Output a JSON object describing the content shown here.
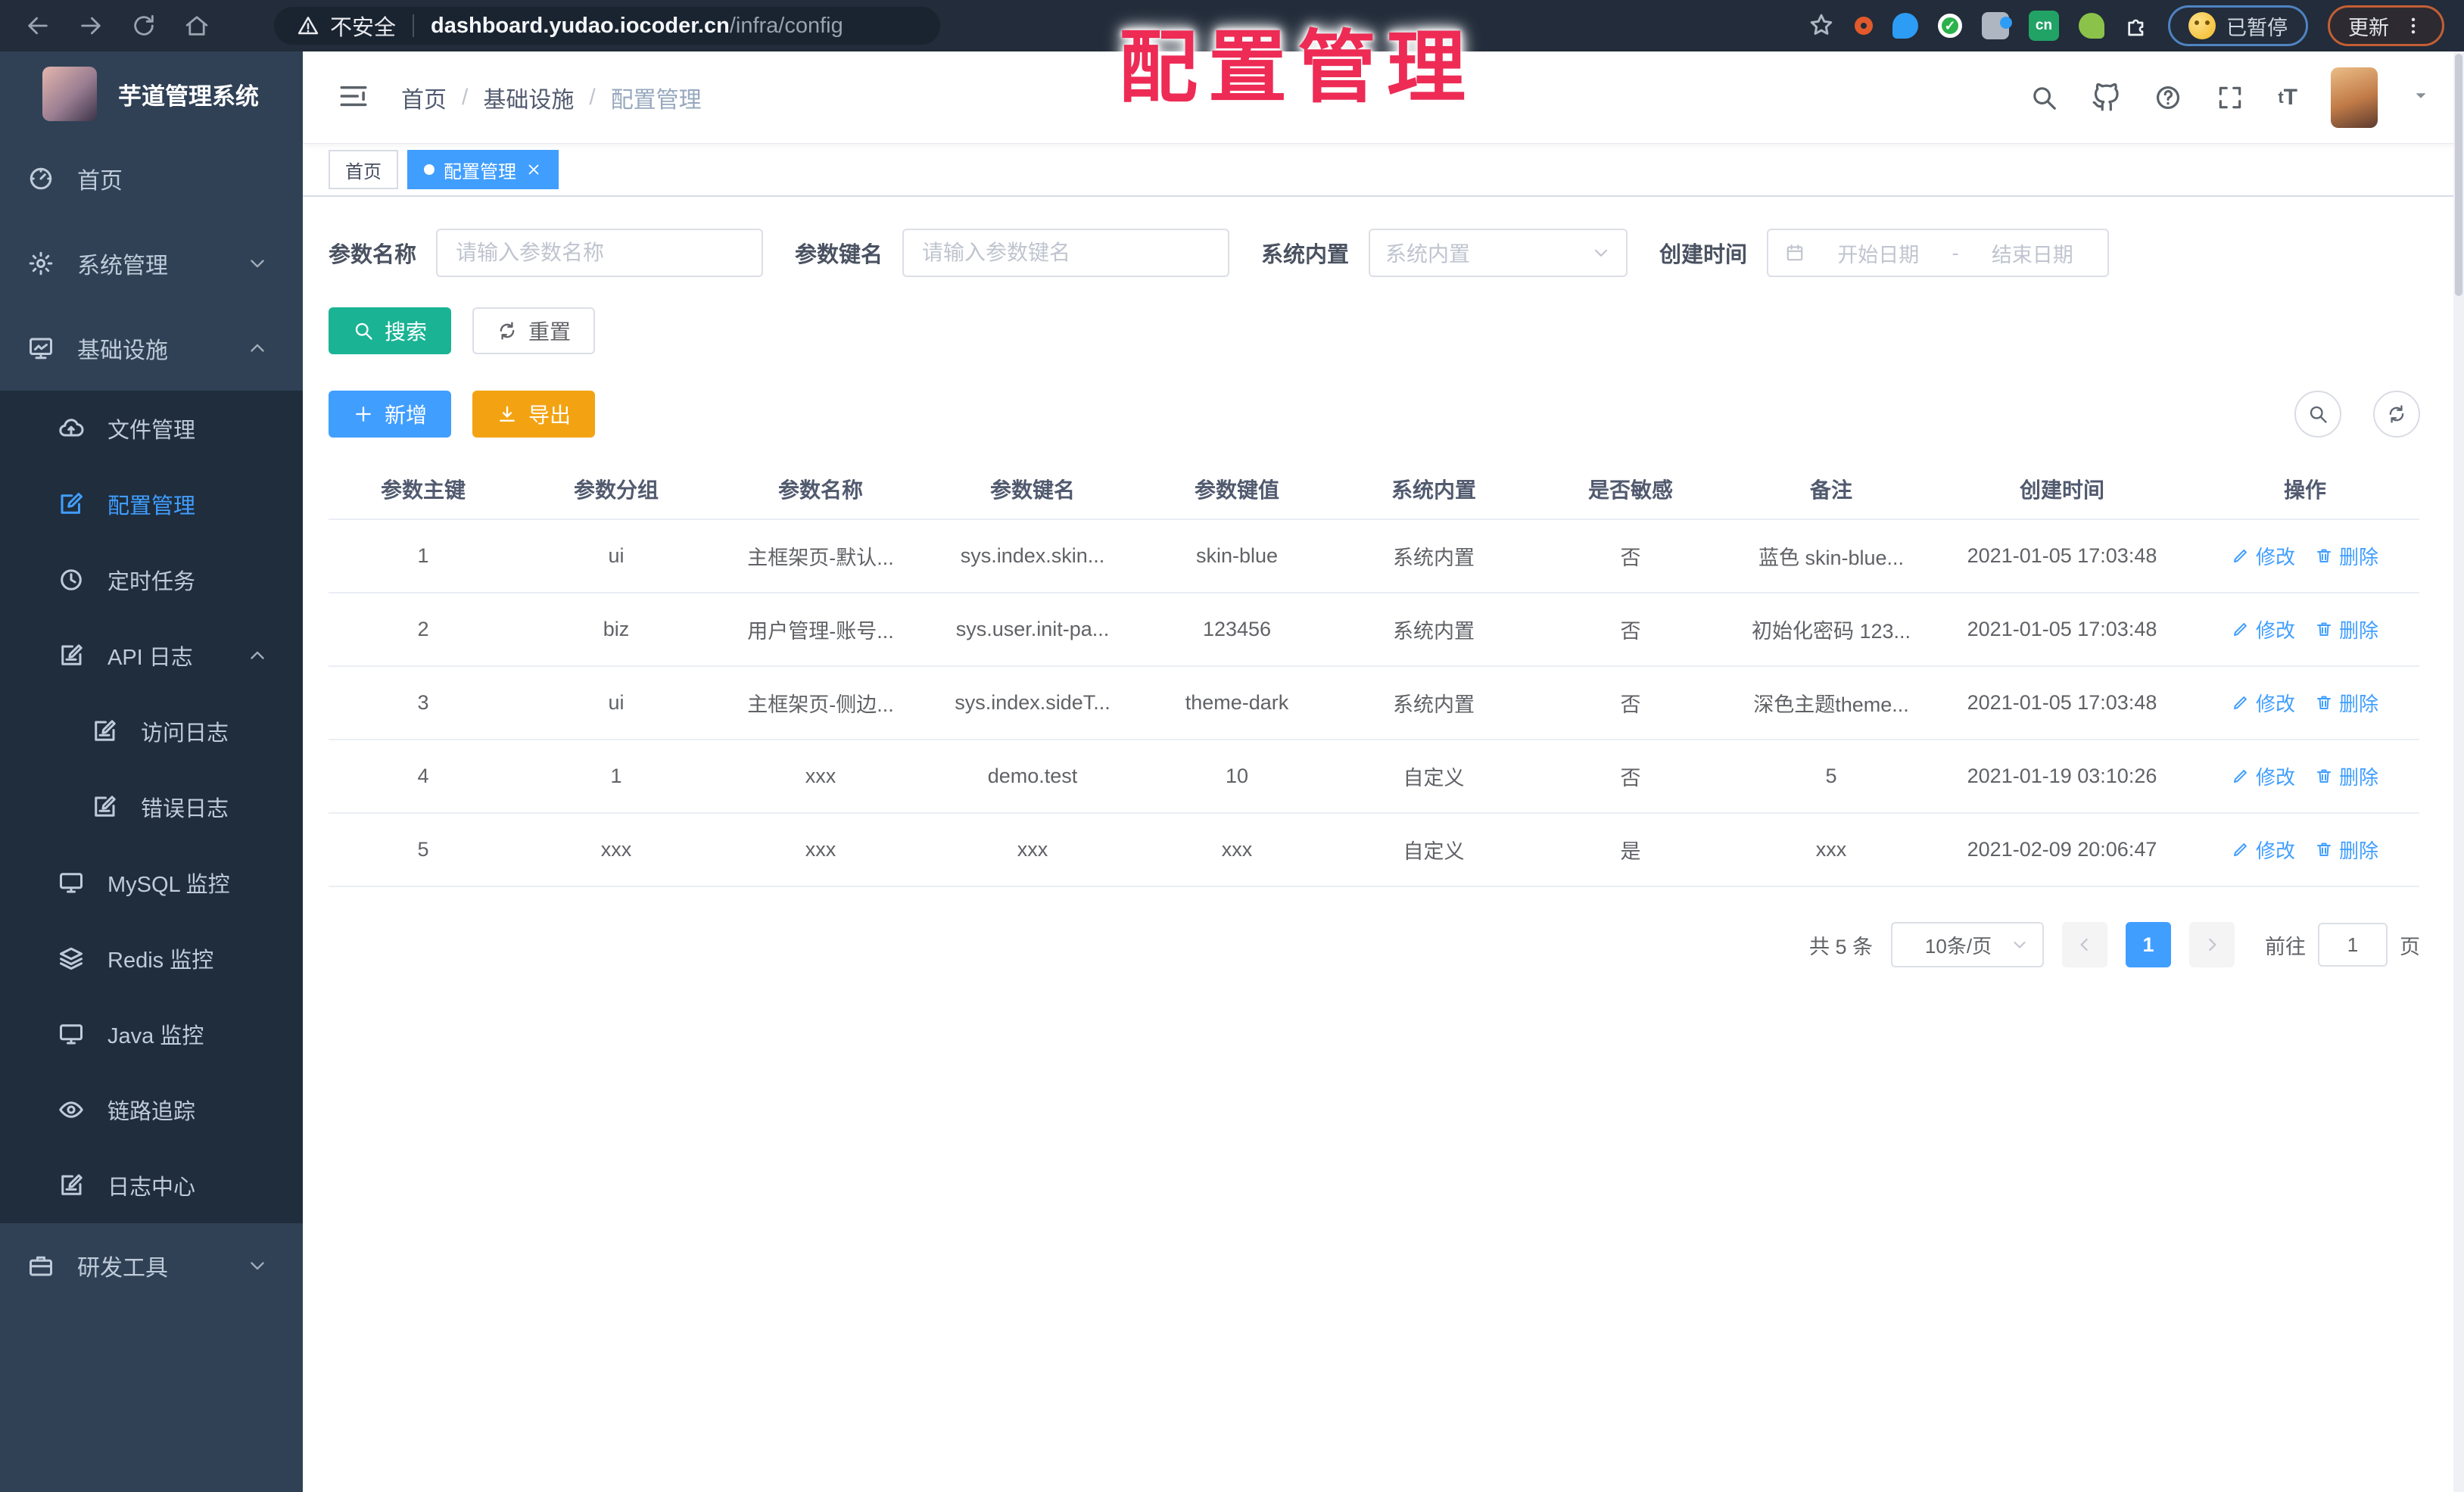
{
  "overlay": {
    "title": "配置管理"
  },
  "browser": {
    "security_text": "不安全",
    "url_domain": "dashboard.yudao.iocoder.cn",
    "url_path": "/infra/config",
    "paused_label": "已暂停",
    "update_label": "更新"
  },
  "sidebar": {
    "app_title": "芋道管理系统",
    "menu": [
      {
        "label": "首页",
        "icon": "dashboard-icon",
        "level": 1
      },
      {
        "label": "系统管理",
        "icon": "gear-icon",
        "level": 1,
        "chevron": "down"
      },
      {
        "label": "基础设施",
        "icon": "infrastructure-icon",
        "level": 1,
        "chevron": "up"
      },
      {
        "label": "文件管理",
        "icon": "cloud-upload-icon",
        "level": 2
      },
      {
        "label": "配置管理",
        "icon": "edit-square-icon",
        "level": 2,
        "active": true
      },
      {
        "label": "定时任务",
        "icon": "clock-icon",
        "level": 2
      },
      {
        "label": "API 日志",
        "icon": "log-icon",
        "level": 2,
        "chevron": "up"
      },
      {
        "label": "访问日志",
        "icon": "log-icon",
        "level": 3
      },
      {
        "label": "错误日志",
        "icon": "log-icon",
        "level": 3
      },
      {
        "label": "MySQL 监控",
        "icon": "monitor-icon",
        "level": 2
      },
      {
        "label": "Redis 监控",
        "icon": "layers-icon",
        "level": 2
      },
      {
        "label": "Java 监控",
        "icon": "monitor-icon",
        "level": 2
      },
      {
        "label": "链路追踪",
        "icon": "eye-icon",
        "level": 2
      },
      {
        "label": "日志中心",
        "icon": "log-icon",
        "level": 2
      },
      {
        "label": "研发工具",
        "icon": "briefcase-icon",
        "level": 1,
        "chevron": "down"
      }
    ]
  },
  "header": {
    "breadcrumb": [
      "首页",
      "基础设施",
      "配置管理"
    ],
    "breadcrumb_separator": "/"
  },
  "tags": [
    {
      "label": "首页"
    },
    {
      "label": "配置管理"
    }
  ],
  "filter": {
    "name_label": "参数名称",
    "name_placeholder": "请输入参数名称",
    "key_label": "参数键名",
    "key_placeholder": "请输入参数键名",
    "type_label": "系统内置",
    "type_placeholder": "系统内置",
    "date_label": "创建时间",
    "date_start": "开始日期",
    "date_separator": "-",
    "date_end": "结束日期",
    "search_label": "搜索",
    "reset_label": "重置"
  },
  "toolbar": {
    "add_label": "新增",
    "export_label": "导出"
  },
  "table": {
    "columns": [
      "参数主键",
      "参数分组",
      "参数名称",
      "参数键名",
      "参数键值",
      "系统内置",
      "是否敏感",
      "备注",
      "创建时间",
      "操作"
    ],
    "rows": [
      [
        "1",
        "ui",
        "主框架页-默认...",
        "sys.index.skin...",
        "skin-blue",
        "系统内置",
        "否",
        "蓝色 skin-blue...",
        "2021-01-05 17:03:48"
      ],
      [
        "2",
        "biz",
        "用户管理-账号...",
        "sys.user.init-pa...",
        "123456",
        "系统内置",
        "否",
        "初始化密码 123...",
        "2021-01-05 17:03:48"
      ],
      [
        "3",
        "ui",
        "主框架页-侧边...",
        "sys.index.sideT...",
        "theme-dark",
        "系统内置",
        "否",
        "深色主题theme...",
        "2021-01-05 17:03:48"
      ],
      [
        "4",
        "1",
        "xxx",
        "demo.test",
        "10",
        "自定义",
        "否",
        "5",
        "2021-01-19 03:10:26"
      ],
      [
        "5",
        "xxx",
        "xxx",
        "xxx",
        "xxx",
        "自定义",
        "是",
        "xxx",
        "2021-02-09 20:06:47"
      ]
    ],
    "edit_label": "修改",
    "delete_label": "删除"
  },
  "pagination": {
    "total": "共 5 条",
    "size": "10条/页",
    "page": "1",
    "goto": "前往",
    "goto_value": "1",
    "unit": "页"
  },
  "colors": {
    "accent": "#409eff",
    "search_button": "#1ab394",
    "export_button": "#f3a312",
    "sidebar_bg": "#304156",
    "submenu_bg": "#1f2d3d",
    "watermark": "#ed2b55"
  }
}
